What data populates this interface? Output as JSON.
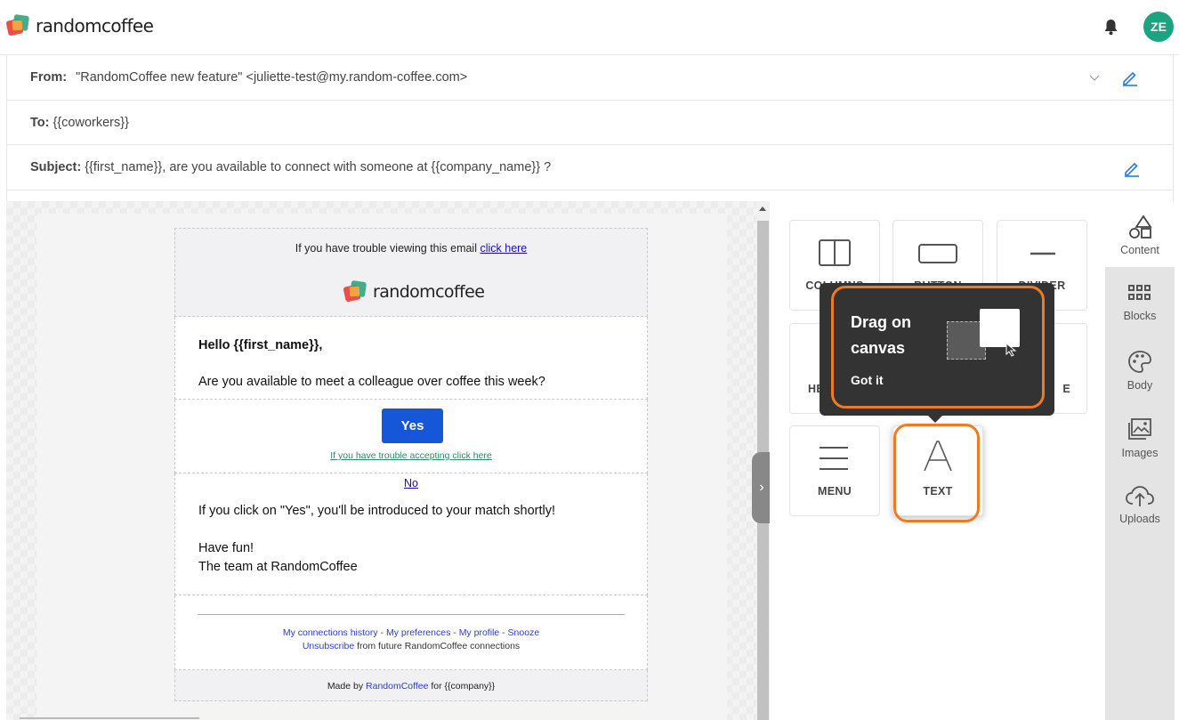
{
  "app": {
    "name": "randomcoffee",
    "user_initials": "ZE"
  },
  "colors": {
    "accent": "#1ba481",
    "button": "#1656d8",
    "highlight": "#f07a22",
    "tooltip_bg": "#333333"
  },
  "header": {
    "from_label": "From:",
    "from_value": "\"RandomCoffee new feature\" <juliette-test@my.random-coffee.com>",
    "to_label": "To:",
    "to_value": "{{coworkers}}",
    "subject_label": "Subject:",
    "subject_value": "{{first_name}}, are you available to connect with someone at {{company_name}} ?"
  },
  "email": {
    "trouble_text": "If you have trouble viewing this email ",
    "trouble_link": "click here",
    "logo_text": "randomcoffee",
    "greeting": "Hello {{first_name}},",
    "question": "Are you available to meet a colleague over coffee this week?",
    "yes_label": "Yes",
    "accept_trouble": "If you have trouble accepting click here",
    "no_label": "No",
    "click_info": "If you click on \"Yes\", you'll be introduced to your match shortly!",
    "sign1": "Have fun!",
    "sign2": "The team at RandomCoffee",
    "footer_links": [
      "My connections history",
      "My preferences",
      "My profile",
      "Snooze"
    ],
    "footer_sep": " - ",
    "unsubscribe": "Unsubscribe",
    "unsubscribe_rest": " from future RandomCoffee connections",
    "made_by": "Made by ",
    "made_by_link": "RandomCoffee",
    "made_by_rest": " for {{company}}"
  },
  "tools": {
    "columns": "COLUMNS",
    "button": "BUTTON",
    "divider": "DIVIDER",
    "heading_partial": "HE",
    "image_partial": "E",
    "menu": "MENU",
    "text": "TEXT"
  },
  "tooltip": {
    "title": "Drag on canvas",
    "dismiss": "Got it"
  },
  "sidebar": [
    {
      "label": "Content",
      "icon": "shapes-icon"
    },
    {
      "label": "Blocks",
      "icon": "grid-icon"
    },
    {
      "label": "Body",
      "icon": "palette-icon"
    },
    {
      "label": "Images",
      "icon": "images-icon"
    },
    {
      "label": "Uploads",
      "icon": "cloud-upload-icon"
    }
  ]
}
